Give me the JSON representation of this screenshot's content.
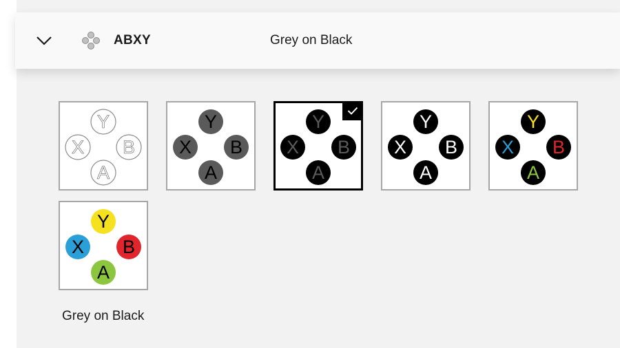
{
  "header": {
    "title": "ABXY",
    "value": "Grey on Black"
  },
  "caption": "Grey on Black",
  "button_letters": {
    "y": "Y",
    "x": "X",
    "b": "B",
    "a": "A"
  },
  "styles": [
    {
      "name": "outline-white",
      "selected": false,
      "fill": {
        "y": "#ffffff",
        "x": "#ffffff",
        "b": "#ffffff",
        "a": "#ffffff"
      },
      "stroke": "#8c8c8c",
      "text": {
        "y": "#595959",
        "x": "#595959",
        "b": "#595959",
        "a": "#595959"
      }
    },
    {
      "name": "black-on-grey",
      "selected": false,
      "fill": {
        "y": "#5a5a5a",
        "x": "#5a5a5a",
        "b": "#5a5a5a",
        "a": "#5a5a5a"
      },
      "stroke": "none",
      "text": {
        "y": "#000000",
        "x": "#000000",
        "b": "#000000",
        "a": "#000000"
      }
    },
    {
      "name": "grey-on-black",
      "selected": true,
      "fill": {
        "y": "#000000",
        "x": "#000000",
        "b": "#000000",
        "a": "#000000"
      },
      "stroke": "none",
      "text": {
        "y": "#5a5a5a",
        "x": "#5a5a5a",
        "b": "#5a5a5a",
        "a": "#5a5a5a"
      }
    },
    {
      "name": "white-on-black",
      "selected": false,
      "fill": {
        "y": "#000000",
        "x": "#000000",
        "b": "#000000",
        "a": "#000000"
      },
      "stroke": "none",
      "text": {
        "y": "#ffffff",
        "x": "#ffffff",
        "b": "#ffffff",
        "a": "#ffffff"
      }
    },
    {
      "name": "color-on-black",
      "selected": false,
      "fill": {
        "y": "#000000",
        "x": "#000000",
        "b": "#000000",
        "a": "#000000"
      },
      "stroke": "none",
      "text": {
        "y": "#f5e11d",
        "x": "#2a9fd8",
        "b": "#e0262c",
        "a": "#8cc63f"
      }
    },
    {
      "name": "black-on-color",
      "selected": false,
      "fill": {
        "y": "#f5e11d",
        "x": "#2a9fd8",
        "b": "#e0262c",
        "a": "#8cc63f"
      },
      "stroke": "none",
      "text": {
        "y": "#000000",
        "x": "#000000",
        "b": "#000000",
        "a": "#000000"
      }
    }
  ]
}
